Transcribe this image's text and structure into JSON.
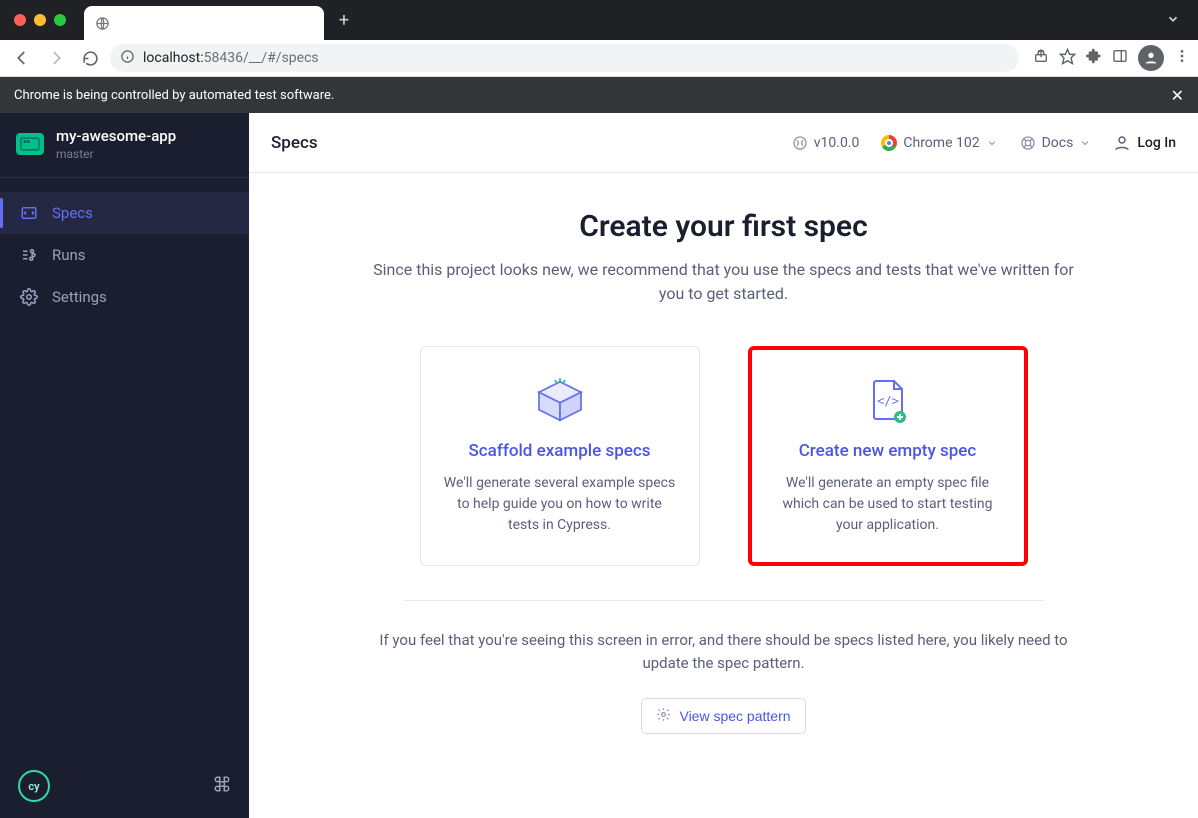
{
  "chrome": {
    "url_host": "localhost:",
    "url_port_path": "58436/__/#/specs",
    "automation_banner": "Chrome is being controlled by automated test software."
  },
  "sidebar": {
    "project_name": "my-awesome-app",
    "branch": "master",
    "items": [
      {
        "label": "Specs"
      },
      {
        "label": "Runs"
      },
      {
        "label": "Settings"
      }
    ],
    "logo_text": "cy"
  },
  "topbar": {
    "title": "Specs",
    "version": "v10.0.0",
    "browser": "Chrome 102",
    "docs": "Docs",
    "login": "Log In"
  },
  "hero": {
    "title": "Create your first spec",
    "subtitle": "Since this project looks new, we recommend that you use the specs and tests that we've written for you to get started."
  },
  "cards": {
    "scaffold": {
      "title": "Scaffold example specs",
      "desc": "We'll generate several example specs to help guide you on how to write tests in Cypress."
    },
    "empty": {
      "title": "Create new empty spec",
      "desc": "We'll generate an empty spec file which can be used to start testing your application."
    }
  },
  "note": "If you feel that you're seeing this screen in error, and there should be specs listed here, you likely need to update the spec pattern.",
  "pattern_btn": "View spec pattern"
}
